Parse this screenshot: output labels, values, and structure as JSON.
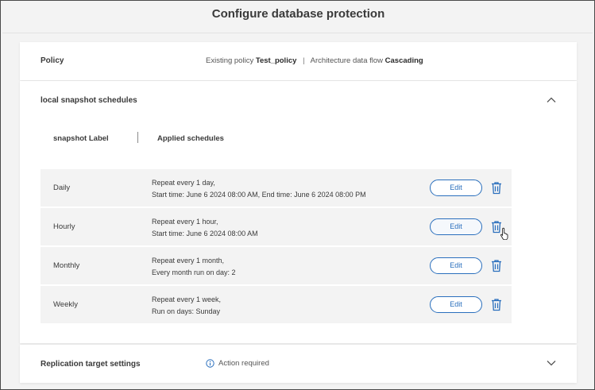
{
  "page": {
    "title": "Configure database protection"
  },
  "policy": {
    "label": "Policy",
    "existing_prefix": "Existing policy",
    "existing_name": "Test_policy",
    "separator": "|",
    "arch_prefix": "Architecture data flow",
    "arch_value": "Cascading"
  },
  "snapshots": {
    "title": "local snapshot schedules",
    "col_label": "snapshot  Label",
    "col_schedules": "Applied schedules",
    "edit_label": "Edit",
    "rows": [
      {
        "label": "Daily",
        "line1": "Repeat every 1 day,",
        "line2": "Start time: June 6 2024 08:00 AM, End time: June 6 2024 08:00 PM"
      },
      {
        "label": "Hourly",
        "line1": "Repeat every 1 hour,",
        "line2": "Start time: June 6 2024 08:00 AM"
      },
      {
        "label": "Monthly",
        "line1": "Repeat every 1 month,",
        "line2": "Every month run on day: 2"
      },
      {
        "label": "Weekly",
        "line1": "Repeat every 1 week,",
        "line2": "Run on days: Sunday"
      }
    ]
  },
  "replication": {
    "title": "Replication target settings",
    "status": "Action required"
  },
  "colors": {
    "accent": "#2a6fbd",
    "row_bg": "#f3f3f3",
    "card_bg": "#ffffff"
  },
  "icons": {
    "collapse": "chevron-up-icon",
    "expand": "chevron-down-icon",
    "delete": "trash-icon",
    "info": "info-icon",
    "cursor": "hand-pointer-icon"
  }
}
